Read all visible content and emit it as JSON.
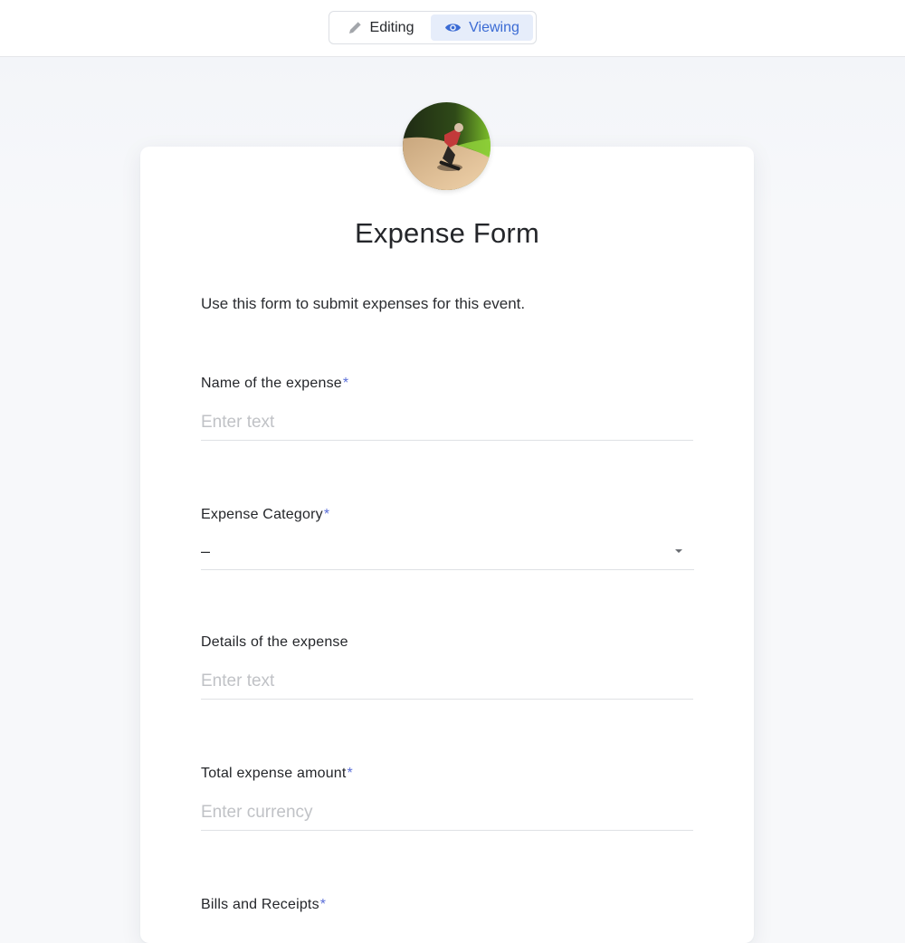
{
  "mode_toggle": {
    "editing_label": "Editing",
    "viewing_label": "Viewing",
    "active": "Viewing",
    "editing_icon": "pencil-icon",
    "viewing_icon": "eye-icon"
  },
  "form": {
    "avatar_icon": "skateboarder-photo",
    "title": "Expense Form",
    "description": "Use this form to submit expenses for this event.",
    "required_marker": "*",
    "fields": [
      {
        "label": "Name of the expense",
        "required": true,
        "placeholder": "Enter text"
      },
      {
        "label": "Expense Category",
        "required": true,
        "value": "–"
      },
      {
        "label": "Details of the expense",
        "required": false,
        "placeholder": "Enter text"
      },
      {
        "label": "Total expense amount",
        "required": true,
        "placeholder": "Enter currency"
      },
      {
        "label": "Bills and Receipts",
        "required": true
      }
    ]
  },
  "colors": {
    "accent": "#3b6bd4",
    "accent_bg": "#e6edfa",
    "required": "#5b6fd8",
    "placeholder": "#c0c2c6"
  }
}
